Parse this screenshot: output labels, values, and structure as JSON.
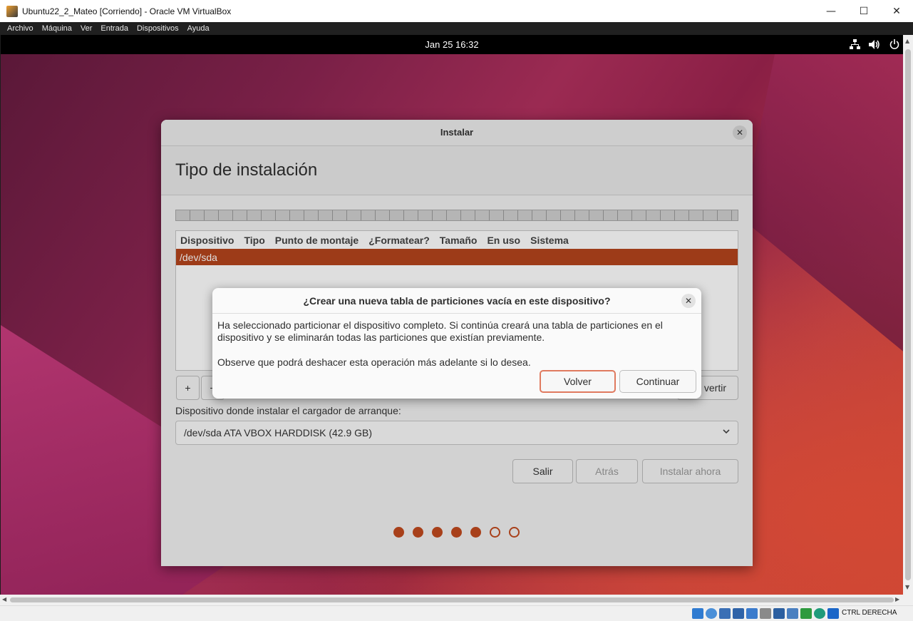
{
  "window": {
    "title": "Ubuntu22_2_Mateo [Corriendo] - Oracle VM VirtualBox",
    "minimize_glyph": "—",
    "maximize_glyph": "☐",
    "close_glyph": "✕"
  },
  "menubar": {
    "items": [
      "Archivo",
      "Máquina",
      "Ver",
      "Entrada",
      "Dispositivos",
      "Ayuda"
    ]
  },
  "panel": {
    "clock": "Jan 25  16:32",
    "icons": [
      "network-icon",
      "volume-icon",
      "power-icon"
    ]
  },
  "installer": {
    "window_title": "Instalar",
    "page_title": "Tipo de instalación",
    "table": {
      "columns": [
        "Dispositivo",
        "Tipo",
        "Punto de montaje",
        "¿Formatear?",
        "Tamaño",
        "En uso",
        "Sistema"
      ],
      "rows": [
        "/dev/sda"
      ]
    },
    "toolbar": {
      "add_label": "+",
      "remove_label": "−",
      "revert_label": "Revertir",
      "revert_visible": "vertir"
    },
    "bootloader_label": "Dispositivo donde instalar el cargador de arranque:",
    "bootloader_value": "/dev/sda ATA VBOX HARDDISK (42.9 GB)",
    "buttons": {
      "quit": "Salir",
      "back": "Atrás",
      "install_now": "Instalar ahora"
    },
    "progress": {
      "completed_steps": 5,
      "total_steps": 7
    }
  },
  "dialog": {
    "title": "¿Crear una nueva tabla de particiones vacía en este dispositivo?",
    "message": "Ha seleccionado particionar el dispositivo completo. Si continúa creará una tabla de particiones en el dispositivo y se eliminarán todas las particiones que existían previamente.",
    "note": "Observe que podrá deshacer esta operación más adelante si lo desea.",
    "back_label": "Volver",
    "continue_label": "Continuar"
  },
  "statusbar": {
    "host_key": "CTRL DERECHA"
  },
  "colors": {
    "ubuntu_accent": "#c24a1e",
    "selected_row": "#b5441c"
  }
}
